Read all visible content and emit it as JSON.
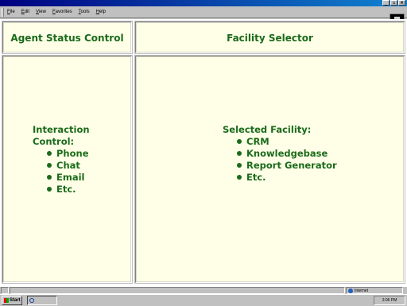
{
  "menu": {
    "items": [
      "File",
      "Edit",
      "View",
      "Favorites",
      "Tools",
      "Help"
    ]
  },
  "window_buttons": {
    "minimize": "_",
    "maximize": "▫",
    "close": "×"
  },
  "left_header": {
    "title": "Agent Status Control"
  },
  "right_header": {
    "title": "Facility Selector"
  },
  "interaction": {
    "heading_line1": "Interaction",
    "heading_line2": "Control:",
    "items": [
      "Phone",
      "Chat",
      "Email",
      "Etc."
    ]
  },
  "facility": {
    "heading": "Selected Facility:",
    "items": [
      "CRM",
      "Knowledgebase",
      "Report Generator",
      "Etc."
    ]
  },
  "statusbar": {
    "zone": "Internet"
  },
  "taskbar": {
    "start_label": "Start",
    "clock": "3:06 PM"
  },
  "colors": {
    "text_green": "#1a6b1a",
    "frame_bg": "#ffffe8",
    "titlebar": "#000080"
  }
}
